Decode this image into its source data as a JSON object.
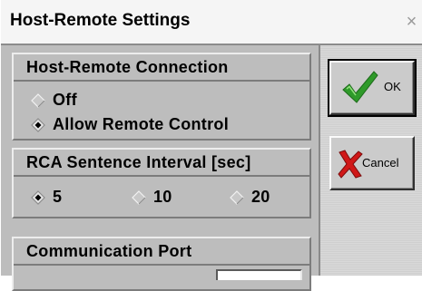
{
  "window": {
    "title": "Host-Remote Settings",
    "close_glyph": "×"
  },
  "host_remote_connection": {
    "title": "Host-Remote Connection",
    "options": [
      {
        "label": "Off",
        "selected": false
      },
      {
        "label": "Allow Remote Control",
        "selected": true
      }
    ]
  },
  "rca_interval": {
    "title": "RCA Sentence Interval [sec]",
    "options": [
      {
        "label": "5",
        "selected": true
      },
      {
        "label": "10",
        "selected": false
      },
      {
        "label": "20",
        "selected": false
      }
    ]
  },
  "communication_port": {
    "title": "Communication Port",
    "value": ""
  },
  "buttons": {
    "ok_label": "OK",
    "cancel_label": "Cancel",
    "ok_icon": "checkmark-icon",
    "cancel_icon": "x-mark-icon"
  },
  "colors": {
    "checkmark_green": "#2f9a2a",
    "cancel_red": "#d01818"
  }
}
